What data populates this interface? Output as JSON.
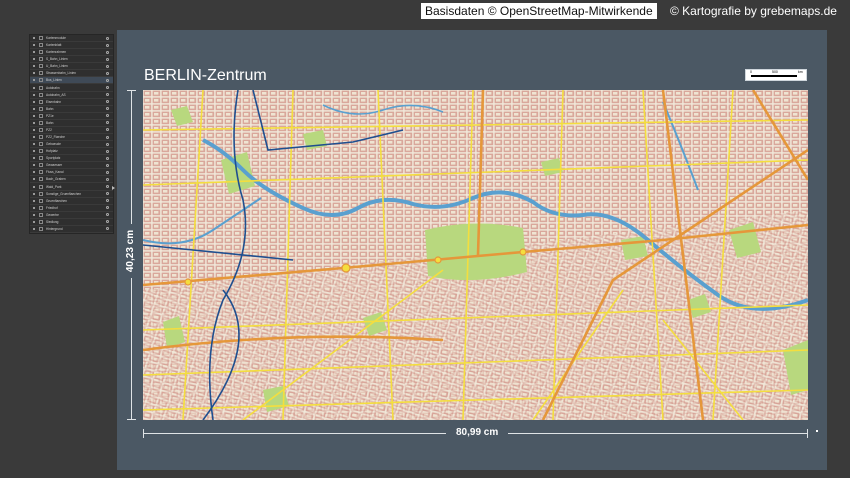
{
  "credits": {
    "osm": "Basisdaten © OpenStreetMap-Mitwirkende",
    "carto": "© Kartografie by grebemaps.de"
  },
  "layers": [
    "Kartenmodule",
    "Kartenblatt",
    "Kartenrahmen",
    "S_Bahn_Linien",
    "U_Bahn_Linien",
    "Strassenbahn_Linien",
    "Bus_Linien",
    "Autobahn",
    "Autobahn_AS",
    "Eisenbahn",
    "Bahn",
    "PZ1e",
    "Bahn",
    "PZ2",
    "PZ2_Flaeche",
    "Gebaeude",
    "Hofplatz",
    "Sportplatz",
    "Gewaesser",
    "Fluss_Kanal",
    "Bach_Graben",
    "Wald_Park",
    "Sonstige_Gruenflaechen",
    "Gruenflaechen",
    "Friedhof",
    "Gewerbe",
    "Siedlung",
    "Hintergrund"
  ],
  "selected_layer_index": 6,
  "map": {
    "title": "BERLIN-Zentrum",
    "height_label": "40,23 cm",
    "width_label": "80,99 cm",
    "scale": {
      "start": "0",
      "mid": "500",
      "unit": "km"
    }
  },
  "colors": {
    "artboard": "#4b5864",
    "water": "#5aa0cf",
    "green": "#b8d87e",
    "built": "#d9a79b",
    "major_road": "#e5973a",
    "road": "#f4de3e",
    "rail": "#1f4f8f"
  }
}
